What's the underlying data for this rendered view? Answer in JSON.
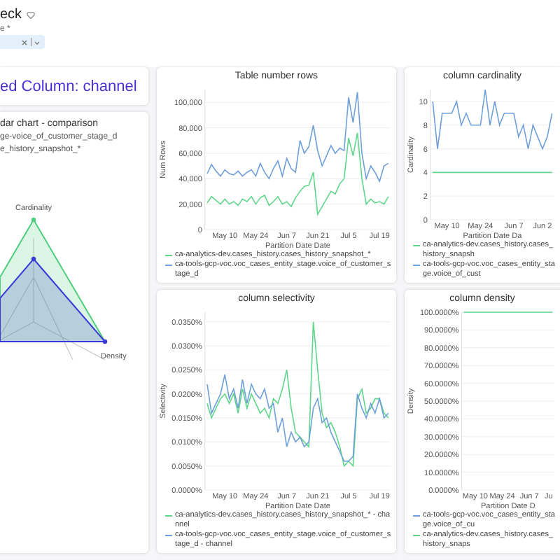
{
  "header": {
    "title": "eck",
    "field_label": "e *"
  },
  "left": {
    "heading": "ed Column: channel",
    "radar": {
      "title": "dar chart - comparison",
      "legend": [
        "ge-voice_of_customer_stage_d",
        "e_history_snapshot_*"
      ],
      "axis_labels": [
        "Cardinality",
        "Density"
      ]
    }
  },
  "charts": [
    {
      "chart_data": {
        "type": "line",
        "title": "Table number rows",
        "grid": true,
        "xlabel": "Partition Date Date",
        "ylabel": "Num Rows",
        "ylim": [
          0,
          110000
        ],
        "yticks": [
          {
            "value": 0,
            "label": "0"
          },
          {
            "value": 20000,
            "label": "20,000"
          },
          {
            "value": 40000,
            "label": "40,000"
          },
          {
            "value": 60000,
            "label": "60,000"
          },
          {
            "value": 80000,
            "label": "80,000"
          },
          {
            "value": 100000,
            "label": "100,000"
          }
        ],
        "categories": [
          null,
          null,
          null,
          null,
          "May 10",
          null,
          null,
          null,
          null,
          null,
          null,
          "May 24",
          null,
          null,
          null,
          null,
          null,
          null,
          "Jun 7",
          null,
          null,
          null,
          null,
          null,
          null,
          "Jun 21",
          null,
          null,
          null,
          null,
          null,
          null,
          "Jul 5",
          null,
          null,
          null,
          null,
          null,
          null,
          "Jul 19",
          null,
          null
        ],
        "series": [
          {
            "name": "ca-analytics-dev.cases_history.cases_history_snapshot_*",
            "color": "#5fd68a",
            "values": [
              21000,
              26000,
              23000,
              20000,
              24000,
              20000,
              22000,
              19000,
              24000,
              22000,
              26000,
              20000,
              25000,
              27000,
              19000,
              22000,
              26000,
              20000,
              22000,
              18000,
              25000,
              30000,
              34000,
              35000,
              45000,
              12000,
              18000,
              24000,
              30000,
              28000,
              36000,
              40000,
              72000,
              58000,
              76000,
              40000,
              20000,
              24000,
              21000,
              22000,
              20000,
              26000
            ]
          },
          {
            "name": "ca-tools-gcp-voc.voc_cases_entity_stage.voice_of_customer_stage_d",
            "color": "#6f9fd8",
            "values": [
              44000,
              51000,
              46000,
              42000,
              47000,
              44000,
              43000,
              46000,
              42000,
              45000,
              47000,
              42000,
              52000,
              45000,
              40000,
              48000,
              54000,
              42000,
              56000,
              48000,
              45000,
              70000,
              60000,
              65000,
              82000,
              62000,
              50000,
              58000,
              66000,
              60000,
              64000,
              62000,
              104000,
              84000,
              108000,
              60000,
              40000,
              50000,
              45000,
              38000,
              50000,
              52000
            ]
          }
        ]
      }
    },
    {
      "chart_data": {
        "type": "line",
        "title": "column cardinality",
        "grid": true,
        "xlabel": "Partition Date Da",
        "ylabel": "Cardinality",
        "ylim": [
          0,
          11
        ],
        "yticks": [
          0,
          2,
          4,
          6,
          8,
          10
        ],
        "categories": [
          null,
          null,
          null,
          "May 10",
          null,
          null,
          null,
          null,
          null,
          null,
          "May 24",
          null,
          null,
          null,
          null,
          null,
          null,
          "Jun 7",
          null,
          null,
          null,
          null,
          null,
          "Jun 2",
          null,
          null
        ],
        "series": [
          {
            "name": "ca-analytics-dev.cases_history.cases_history_snapsh",
            "color": "#5fd68a",
            "values": [
              4,
              4,
              4,
              4,
              4,
              4,
              4,
              4,
              4,
              4,
              4,
              4,
              4,
              4,
              4,
              4,
              4,
              4,
              4,
              4,
              4,
              4,
              4,
              4,
              4,
              4
            ]
          },
          {
            "name": "ca-tools-gcp-voc.voc_cases_entity_stage.voice_of_cust",
            "color": "#6f9fd8",
            "values": [
              10,
              6,
              9,
              9,
              9,
              10,
              8,
              9,
              8,
              8,
              8,
              11,
              8,
              10,
              8,
              9,
              9,
              9,
              7,
              8,
              6,
              8,
              7,
              6,
              7,
              9
            ]
          }
        ]
      }
    },
    {
      "chart_data": {
        "type": "line",
        "title": "column selectivity",
        "grid": true,
        "xlabel": "Partition Date Date",
        "ylabel": "Selectivity",
        "ylim": [
          0,
          0.037
        ],
        "yticks": [
          {
            "value": 0,
            "label": "0.0000%"
          },
          {
            "value": 0.005,
            "label": "0.0050%"
          },
          {
            "value": 0.01,
            "label": "0.0100%"
          },
          {
            "value": 0.015,
            "label": "0.0150%"
          },
          {
            "value": 0.02,
            "label": "0.0200%"
          },
          {
            "value": 0.025,
            "label": "0.0250%"
          },
          {
            "value": 0.03,
            "label": "0.0300%"
          },
          {
            "value": 0.035,
            "label": "0.0350%"
          }
        ],
        "categories": [
          null,
          null,
          null,
          null,
          "May 10",
          null,
          null,
          null,
          null,
          null,
          null,
          "May 24",
          null,
          null,
          null,
          null,
          null,
          null,
          "Jun 7",
          null,
          null,
          null,
          null,
          null,
          null,
          "Jun 21",
          null,
          null,
          null,
          null,
          null,
          null,
          "Jul 5",
          null,
          null,
          null,
          null,
          null,
          null,
          "Jul 19",
          null,
          null
        ],
        "series": [
          {
            "name": "ca-analytics-dev.cases_history.cases_history_snapshot_* - channel",
            "color": "#5fd68a",
            "values": [
              0.018,
              0.015,
              0.017,
              0.019,
              0.02,
              0.018,
              0.02,
              0.016,
              0.021,
              0.017,
              0.02,
              0.018,
              0.016,
              0.017,
              0.015,
              0.019,
              0.018,
              0.021,
              0.025,
              0.017,
              0.012,
              0.011,
              0.01,
              0.009,
              0.035,
              0.025,
              0.016,
              0.013,
              0.014,
              0.012,
              0.009,
              0.005,
              0.006,
              0.005,
              0.019,
              0.021,
              0.016,
              0.017,
              0.019,
              0.019,
              0.016,
              0.015
            ]
          },
          {
            "name": "ca-tools-gcp-voc.voc_cases_entity_stage.voice_of_customer_stage_d - channel",
            "color": "#6f9fd8",
            "values": [
              0.022,
              0.016,
              0.018,
              0.02,
              0.024,
              0.019,
              0.021,
              0.017,
              0.023,
              0.018,
              0.022,
              0.02,
              0.019,
              0.021,
              0.017,
              0.018,
              0.012,
              0.015,
              0.009,
              0.012,
              0.01,
              0.011,
              0.009,
              0.01,
              0.017,
              0.019,
              0.014,
              0.015,
              0.012,
              0.01,
              0.008,
              0.006,
              0.006,
              0.007,
              0.02,
              0.017,
              0.015,
              0.018,
              0.016,
              0.019,
              0.015,
              0.016
            ]
          }
        ]
      }
    },
    {
      "chart_data": {
        "type": "line",
        "title": "column density",
        "grid": true,
        "xlabel": "Partition Date D",
        "ylabel": "Density",
        "ylim": [
          0,
          100
        ],
        "yticks": [
          {
            "value": 0,
            "label": "0.0000%"
          },
          {
            "value": 10,
            "label": "10.0000%"
          },
          {
            "value": 20,
            "label": "20.0000%"
          },
          {
            "value": 30,
            "label": "30.0000%"
          },
          {
            "value": 40,
            "label": "40.0000%"
          },
          {
            "value": 50,
            "label": "50.0000%"
          },
          {
            "value": 60,
            "label": "60.0000%"
          },
          {
            "value": 70,
            "label": "70.0000%"
          },
          {
            "value": 80,
            "label": "80.0000%"
          },
          {
            "value": 90,
            "label": "90.0000%"
          },
          {
            "value": 100,
            "label": "100.0000%"
          }
        ],
        "categories": [
          null,
          null,
          null,
          "May 10",
          null,
          null,
          null,
          null,
          null,
          null,
          "May 24",
          null,
          null,
          null,
          null,
          null,
          null,
          "Jun 7",
          null,
          null,
          null,
          null,
          "Ju",
          null
        ],
        "series": [
          {
            "name": "ca-tools-gcp-voc.voc_cases_entity_stage.voice_of_cu",
            "color": "#6f9fd8",
            "values": [
              null,
              null,
              null,
              null,
              null,
              null,
              null,
              null,
              null,
              null,
              null,
              null,
              null,
              null,
              null,
              null,
              null,
              null,
              null,
              null,
              null,
              null,
              null,
              null
            ]
          },
          {
            "name": "ca-analytics-dev.cases_history.cases_history_snaps",
            "color": "#5fd68a",
            "values": [
              100,
              100,
              100,
              100,
              100,
              100,
              100,
              100,
              100,
              100,
              100,
              100,
              100,
              100,
              100,
              100,
              100,
              100,
              100,
              100,
              100,
              100,
              100,
              100
            ]
          }
        ]
      }
    }
  ]
}
